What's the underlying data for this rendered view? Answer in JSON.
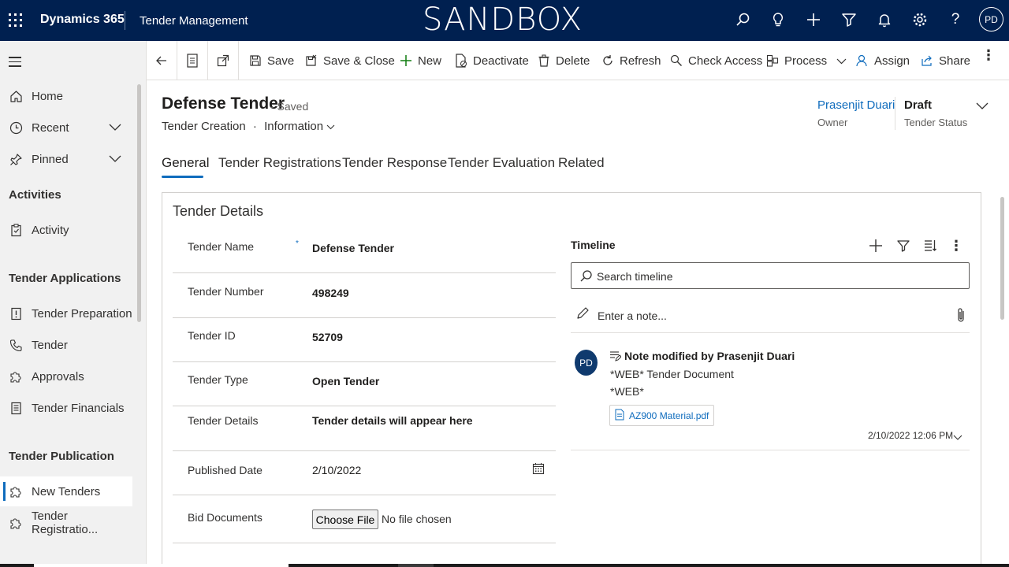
{
  "header": {
    "brand": "Dynamics 365",
    "app_name": "Tender Management",
    "environment": "SANDBOX",
    "user_initials": "PD",
    "icons": [
      "search-icon",
      "lightbulb-icon",
      "add-icon",
      "filter-icon",
      "bell-icon",
      "gear-icon",
      "help-icon"
    ]
  },
  "sidebar": {
    "items": [
      {
        "label": "Home",
        "icon": "home-icon"
      },
      {
        "label": "Recent",
        "icon": "clock-icon"
      },
      {
        "label": "Pinned",
        "icon": "pin-icon"
      }
    ],
    "groups": [
      {
        "title": "Activities",
        "items": [
          {
            "label": "Activity",
            "icon": "clipboard-icon"
          }
        ]
      },
      {
        "title": "Tender Applications",
        "items": [
          {
            "label": "Tender Preparation",
            "icon": "document-alert-icon"
          },
          {
            "label": "Tender",
            "icon": "phone-icon"
          },
          {
            "label": "Approvals",
            "icon": "puzzle-icon"
          },
          {
            "label": "Tender Financials",
            "icon": "document-list-icon"
          }
        ]
      },
      {
        "title": "Tender Publication",
        "items": [
          {
            "label": "New Tenders",
            "icon": "puzzle-icon",
            "active": true
          },
          {
            "label": "Tender Registratio...",
            "icon": "puzzle-icon"
          }
        ]
      }
    ]
  },
  "commands": {
    "save": "Save",
    "save_close": "Save & Close",
    "new": "New",
    "deactivate": "Deactivate",
    "delete": "Delete",
    "refresh": "Refresh",
    "check_access": "Check Access",
    "process": "Process",
    "assign": "Assign",
    "share": "Share"
  },
  "record": {
    "title": "Defense Tender",
    "saved_status": "- Saved",
    "form_entity": "Tender Creation",
    "form_name": "Information",
    "owner_name": "Prasenjit Duari",
    "owner_label": "Owner",
    "status_value": "Draft",
    "status_label": "Tender Status"
  },
  "tabs": [
    "General",
    "Tender Registrations",
    "Tender Response",
    "Tender Evaluation",
    "Related"
  ],
  "section": {
    "title": "Tender Details",
    "fields": [
      {
        "label": "Tender Name",
        "value": "Defense Tender",
        "required": "*"
      },
      {
        "label": "Tender Number",
        "value": "498249"
      },
      {
        "label": "Tender ID",
        "value": "52709"
      },
      {
        "label": "Tender Type",
        "value": "Open Tender"
      },
      {
        "label": "Tender Details",
        "value": "Tender details will appear here"
      },
      {
        "label": "Published Date",
        "value": "2/10/2022"
      },
      {
        "label": "Bid Documents",
        "button": "Choose File",
        "value": "No file chosen"
      }
    ]
  },
  "timeline": {
    "title": "Timeline",
    "search_placeholder": "Search timeline",
    "note_placeholder": "Enter a note...",
    "entry": {
      "avatar": "PD",
      "title": "Note modified by Prasenjit Duari",
      "line1": "*WEB* Tender Document",
      "line2": "*WEB*",
      "attachment": "AZ900 Material.pdf",
      "timestamp": "2/10/2022 12:06 PM"
    }
  },
  "colors": {
    "header_bg": "#002050",
    "accent": "#0f6cbd",
    "sidebar_bg": "#f1f1f1"
  }
}
